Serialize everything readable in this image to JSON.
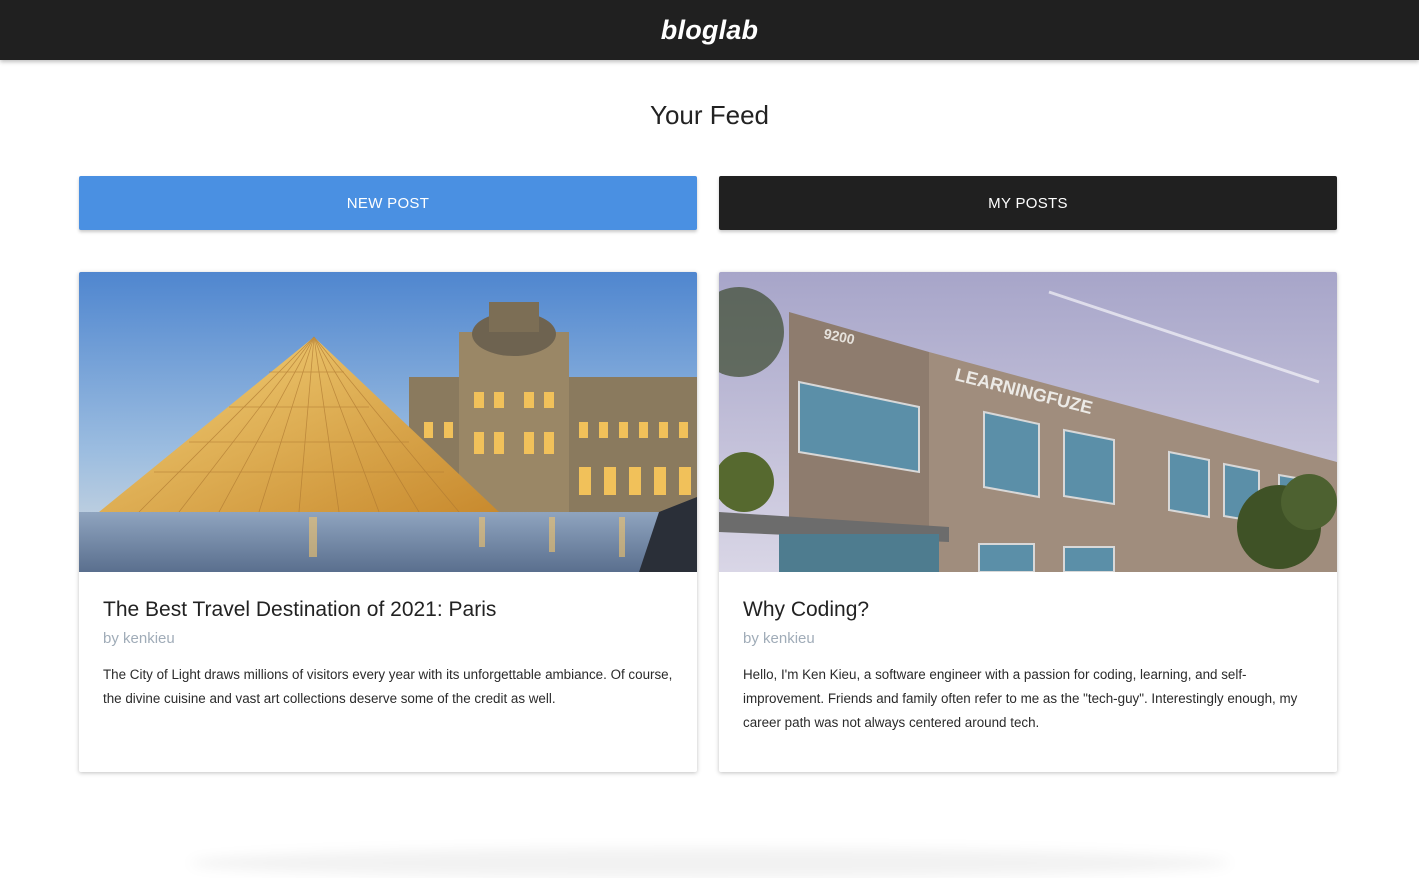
{
  "navbar": {
    "brand": "bloglab"
  },
  "feed": {
    "title": "Your Feed",
    "new_post_label": "NEW POST",
    "my_posts_label": "MY POSTS"
  },
  "posts": [
    {
      "title": "The Best Travel Destination of 2021: Paris",
      "author": "by kenkieu",
      "excerpt": "The City of Light draws millions of visitors every year with its unforgettable ambiance. Of course, the divine cuisine and vast art collections deserve some of the credit as well.",
      "image_alt": "Louvre pyramid and museum at dusk"
    },
    {
      "title": "Why Coding?",
      "author": "by kenkieu",
      "excerpt": "Hello, I'm Ken Kieu, a software engineer with a passion for coding, learning, and self-improvement. Friends and family often refer to me as the \"tech-guy\". Interestingly enough, my career path was not always centered around tech.",
      "image_alt": "LearningFuze building at 9200",
      "image_text_number": "9200",
      "image_text_sign": "LEARNINGFUZE"
    }
  ],
  "colors": {
    "navbar": "#202020",
    "new_post_button": "#4a90e2",
    "my_posts_button": "#202020",
    "author_text": "#a0acb8"
  }
}
